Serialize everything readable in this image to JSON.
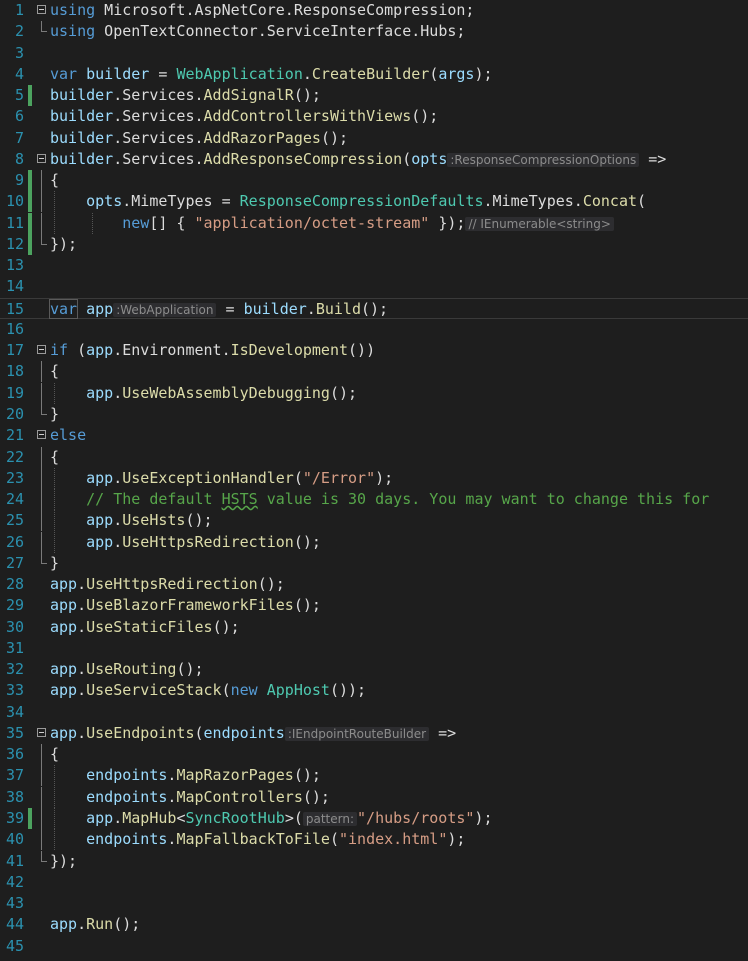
{
  "editor": {
    "lines": [
      {
        "n": "1",
        "code": [
          [
            "kw",
            "using"
          ],
          [
            "pl",
            " Microsoft.AspNetCore.ResponseCompression;"
          ]
        ]
      },
      {
        "n": "2",
        "code": [
          [
            "kw",
            "using"
          ],
          [
            "pl",
            " OpenTextConnector.ServiceInterface.Hubs;"
          ]
        ]
      },
      {
        "n": "3",
        "code": []
      },
      {
        "n": "4",
        "code": [
          [
            "kw",
            "var"
          ],
          [
            "pl",
            " "
          ],
          [
            "id",
            "builder"
          ],
          [
            "pl",
            " = "
          ],
          [
            "ty",
            "WebApplication"
          ],
          [
            "pl",
            "."
          ],
          [
            "mth",
            "CreateBuilder"
          ],
          [
            "pl",
            "("
          ],
          [
            "id",
            "args"
          ],
          [
            "pl",
            ");"
          ]
        ]
      },
      {
        "n": "5",
        "code": [
          [
            "id",
            "builder"
          ],
          [
            "pl",
            ".Services."
          ],
          [
            "mth",
            "AddSignalR"
          ],
          [
            "pl",
            "();"
          ]
        ]
      },
      {
        "n": "6",
        "code": [
          [
            "id",
            "builder"
          ],
          [
            "pl",
            ".Services."
          ],
          [
            "mth",
            "AddControllersWithViews"
          ],
          [
            "pl",
            "();"
          ]
        ]
      },
      {
        "n": "7",
        "code": [
          [
            "id",
            "builder"
          ],
          [
            "pl",
            ".Services."
          ],
          [
            "mth",
            "AddRazorPages"
          ],
          [
            "pl",
            "();"
          ]
        ]
      },
      {
        "n": "8",
        "code": [
          [
            "id",
            "builder"
          ],
          [
            "pl",
            ".Services."
          ],
          [
            "mth",
            "AddResponseCompression"
          ],
          [
            "pl",
            "("
          ],
          [
            "id",
            "opts"
          ],
          [
            "hint",
            ":ResponseCompressionOptions"
          ],
          [
            "pl",
            " =>"
          ]
        ]
      },
      {
        "n": "9",
        "code": [
          [
            "pl",
            "{"
          ]
        ]
      },
      {
        "n": "10",
        "code": [
          [
            "pl",
            "    "
          ],
          [
            "id",
            "opts"
          ],
          [
            "pl",
            ".MimeTypes = "
          ],
          [
            "ty",
            "ResponseCompressionDefaults"
          ],
          [
            "pl",
            ".MimeTypes."
          ],
          [
            "mth",
            "Concat"
          ],
          [
            "pl",
            "("
          ]
        ]
      },
      {
        "n": "11",
        "code": [
          [
            "pl",
            "        "
          ],
          [
            "kw",
            "new"
          ],
          [
            "pl",
            "[] { "
          ],
          [
            "str",
            "\"application/octet-stream\""
          ],
          [
            "pl",
            " });"
          ],
          [
            "hint",
            "// IEnumerable<string>"
          ]
        ]
      },
      {
        "n": "12",
        "code": [
          [
            "pl",
            "});"
          ]
        ]
      },
      {
        "n": "13",
        "code": []
      },
      {
        "n": "14",
        "code": []
      },
      {
        "n": "15",
        "code": [
          [
            "kw",
            "var"
          ],
          [
            "pl",
            " "
          ],
          [
            "id",
            "app"
          ],
          [
            "hint",
            ":WebApplication"
          ],
          [
            "pl",
            " = "
          ],
          [
            "id",
            "builder"
          ],
          [
            "pl",
            "."
          ],
          [
            "mth",
            "Build"
          ],
          [
            "pl",
            "();"
          ]
        ]
      },
      {
        "n": "16",
        "code": []
      },
      {
        "n": "17",
        "code": [
          [
            "kw",
            "if"
          ],
          [
            "pl",
            " ("
          ],
          [
            "id",
            "app"
          ],
          [
            "pl",
            ".Environment."
          ],
          [
            "mth",
            "IsDevelopment"
          ],
          [
            "pl",
            "())"
          ]
        ]
      },
      {
        "n": "18",
        "code": [
          [
            "pl",
            "{"
          ]
        ]
      },
      {
        "n": "19",
        "code": [
          [
            "pl",
            "    "
          ],
          [
            "id",
            "app"
          ],
          [
            "pl",
            "."
          ],
          [
            "mth",
            "UseWebAssemblyDebugging"
          ],
          [
            "pl",
            "();"
          ]
        ]
      },
      {
        "n": "20",
        "code": [
          [
            "pl",
            "}"
          ]
        ]
      },
      {
        "n": "21",
        "code": [
          [
            "kw",
            "else"
          ]
        ]
      },
      {
        "n": "22",
        "code": [
          [
            "pl",
            "{"
          ]
        ]
      },
      {
        "n": "23",
        "code": [
          [
            "pl",
            "    "
          ],
          [
            "id",
            "app"
          ],
          [
            "pl",
            "."
          ],
          [
            "mth",
            "UseExceptionHandler"
          ],
          [
            "pl",
            "("
          ],
          [
            "str",
            "\"/Error\""
          ],
          [
            "pl",
            ");"
          ]
        ]
      },
      {
        "n": "24",
        "code": [
          [
            "pl",
            "    "
          ],
          [
            "cm",
            "// The default "
          ],
          [
            "sq",
            "HSTS"
          ],
          [
            "cm",
            " value is 30 days. You may want to change this for"
          ]
        ]
      },
      {
        "n": "25",
        "code": [
          [
            "pl",
            "    "
          ],
          [
            "id",
            "app"
          ],
          [
            "pl",
            "."
          ],
          [
            "mth",
            "UseHsts"
          ],
          [
            "pl",
            "();"
          ]
        ]
      },
      {
        "n": "26",
        "code": [
          [
            "pl",
            "    "
          ],
          [
            "id",
            "app"
          ],
          [
            "pl",
            "."
          ],
          [
            "mth",
            "UseHttpsRedirection"
          ],
          [
            "pl",
            "();"
          ]
        ]
      },
      {
        "n": "27",
        "code": [
          [
            "pl",
            "}"
          ]
        ]
      },
      {
        "n": "28",
        "code": [
          [
            "id",
            "app"
          ],
          [
            "pl",
            "."
          ],
          [
            "mth",
            "UseHttpsRedirection"
          ],
          [
            "pl",
            "();"
          ]
        ]
      },
      {
        "n": "29",
        "code": [
          [
            "id",
            "app"
          ],
          [
            "pl",
            "."
          ],
          [
            "mth",
            "UseBlazorFrameworkFiles"
          ],
          [
            "pl",
            "();"
          ]
        ]
      },
      {
        "n": "30",
        "code": [
          [
            "id",
            "app"
          ],
          [
            "pl",
            "."
          ],
          [
            "mth",
            "UseStaticFiles"
          ],
          [
            "pl",
            "();"
          ]
        ]
      },
      {
        "n": "31",
        "code": []
      },
      {
        "n": "32",
        "code": [
          [
            "id",
            "app"
          ],
          [
            "pl",
            "."
          ],
          [
            "mth",
            "UseRouting"
          ],
          [
            "pl",
            "();"
          ]
        ]
      },
      {
        "n": "33",
        "code": [
          [
            "id",
            "app"
          ],
          [
            "pl",
            "."
          ],
          [
            "mth",
            "UseServiceStack"
          ],
          [
            "pl",
            "("
          ],
          [
            "kw",
            "new"
          ],
          [
            "pl",
            " "
          ],
          [
            "ty",
            "AppHost"
          ],
          [
            "pl",
            "());"
          ]
        ]
      },
      {
        "n": "34",
        "code": []
      },
      {
        "n": "35",
        "code": [
          [
            "id",
            "app"
          ],
          [
            "pl",
            "."
          ],
          [
            "mth",
            "UseEndpoints"
          ],
          [
            "pl",
            "("
          ],
          [
            "id",
            "endpoints"
          ],
          [
            "hint",
            ":IEndpointRouteBuilder"
          ],
          [
            "pl",
            " =>"
          ]
        ]
      },
      {
        "n": "36",
        "code": [
          [
            "pl",
            "{"
          ]
        ]
      },
      {
        "n": "37",
        "code": [
          [
            "pl",
            "    "
          ],
          [
            "id",
            "endpoints"
          ],
          [
            "pl",
            "."
          ],
          [
            "mth",
            "MapRazorPages"
          ],
          [
            "pl",
            "();"
          ]
        ]
      },
      {
        "n": "38",
        "code": [
          [
            "pl",
            "    "
          ],
          [
            "id",
            "endpoints"
          ],
          [
            "pl",
            "."
          ],
          [
            "mth",
            "MapControllers"
          ],
          [
            "pl",
            "();"
          ]
        ]
      },
      {
        "n": "39",
        "code": [
          [
            "pl",
            "    "
          ],
          [
            "id",
            "app"
          ],
          [
            "pl",
            "."
          ],
          [
            "mth",
            "MapHub"
          ],
          [
            "pl",
            "<"
          ],
          [
            "ty",
            "SyncRootHub"
          ],
          [
            "pl",
            ">("
          ],
          [
            "hint",
            "pattern:"
          ],
          [
            "str",
            "\"/hubs/roots\""
          ],
          [
            "pl",
            ");"
          ]
        ]
      },
      {
        "n": "40",
        "code": [
          [
            "pl",
            "    "
          ],
          [
            "id",
            "endpoints"
          ],
          [
            "pl",
            "."
          ],
          [
            "mth",
            "MapFallbackToFile"
          ],
          [
            "pl",
            "("
          ],
          [
            "str",
            "\"index.html\""
          ],
          [
            "pl",
            ");"
          ]
        ]
      },
      {
        "n": "41",
        "code": [
          [
            "pl",
            "});"
          ]
        ]
      },
      {
        "n": "42",
        "code": []
      },
      {
        "n": "43",
        "code": []
      },
      {
        "n": "44",
        "code": [
          [
            "id",
            "app"
          ],
          [
            "pl",
            "."
          ],
          [
            "mth",
            "Run"
          ],
          [
            "pl",
            "();"
          ]
        ]
      },
      {
        "n": "45",
        "code": []
      }
    ]
  }
}
